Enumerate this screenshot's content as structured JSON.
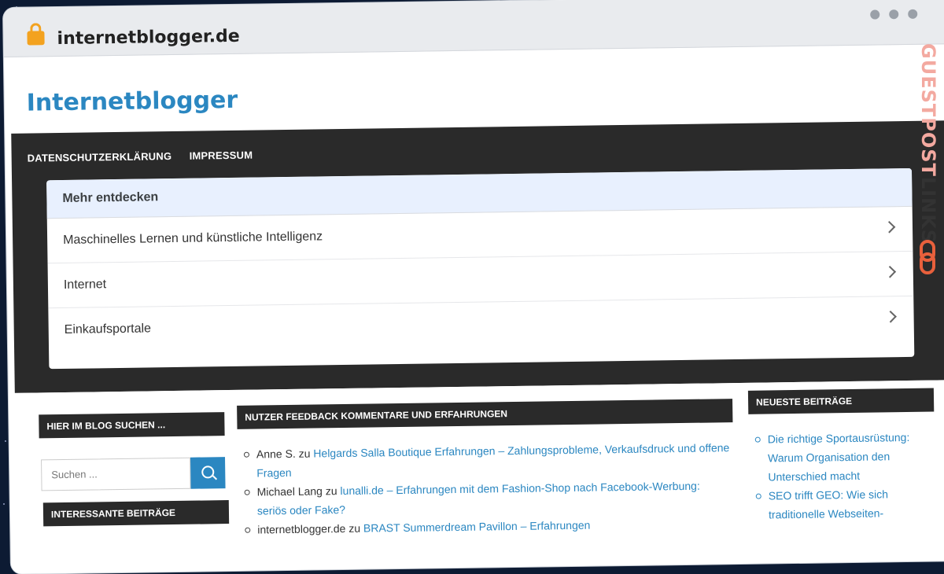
{
  "browser": {
    "url": "internetblogger.de"
  },
  "site": {
    "title": "Internetblogger"
  },
  "nav": {
    "items": [
      "DATENSCHUTZERKLÄRUNG",
      "IMPRESSUM"
    ]
  },
  "discover": {
    "title": "Mehr entdecken",
    "items": [
      "Maschinelles Lernen und künstliche Intelligenz",
      "Internet",
      "Einkaufsportale"
    ]
  },
  "sidebar_left": {
    "search_title": "HIER IM BLOG SUCHEN ...",
    "search_placeholder": "Suchen ...",
    "interesting_title": "INTERESSANTE BEITRÄGE"
  },
  "feedback": {
    "title": "NUTZER FEEDBACK KOMMENTARE UND ERFAHRUNGEN",
    "comments": [
      {
        "author": "Anne S.",
        "connector": "zu",
        "post": "Helgards Salla Boutique Erfahrungen – Zahlungsprobleme, Verkaufsdruck und offene Fragen"
      },
      {
        "author": "Michael Lang",
        "connector": "zu",
        "post": "lunalli.de – Erfahrungen mit dem Fashion-Shop nach Facebook-Werbung: seriös oder Fake?"
      },
      {
        "author": "internetblogger.de",
        "connector": "zu",
        "post": "BRAST Summerdream Pavillon – Erfahrungen"
      }
    ]
  },
  "recent": {
    "title": "NEUESTE BEITRÄGE",
    "items": [
      "Die richtige Sportausrüstung: Warum Organisation den Unterschied macht",
      "SEO trifft GEO: Wie sich traditionelle Webseiten-"
    ]
  },
  "brand": {
    "guest": "GUESTPOST",
    "links": "LINKS"
  },
  "colors": {
    "accent": "#2b87c1",
    "dark": "#2a2a2a",
    "lock": "#f3a21f"
  }
}
